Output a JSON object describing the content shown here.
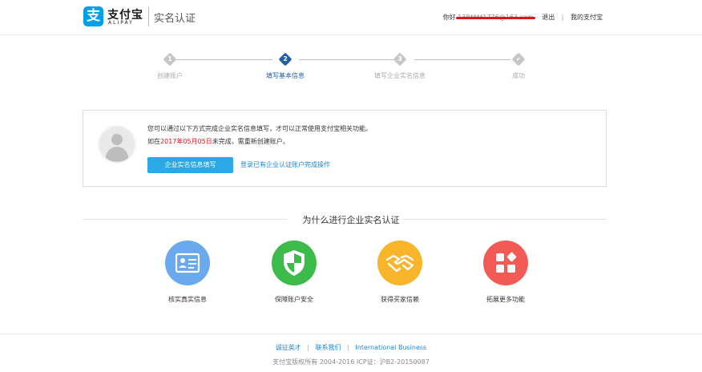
{
  "header": {
    "logo_glyph": "支",
    "logo_cn": "支付宝",
    "logo_en": "ALIPAY",
    "title": "实名认证",
    "greeting": "你好",
    "user": "138****1776@163.com",
    "logout": "退出",
    "my_alipay": "我的支付宝"
  },
  "steps": [
    {
      "num": "1",
      "label": "创建账户",
      "state": "done"
    },
    {
      "num": "2",
      "label": "填写基本信息",
      "state": "active"
    },
    {
      "num": "3",
      "label": "填写企业实名信息",
      "state": "pending"
    },
    {
      "num": "✔",
      "label": "成功",
      "state": "pending"
    }
  ],
  "notice": {
    "line1": "您可以通过以下方式完成企业实名信息填写，才可以正常使用支付宝相关功能。",
    "line2_prefix": "如在",
    "line2_date": "2017年05月05日",
    "line2_suffix": "未完成，需重新创建账户。",
    "primary_button": "企业实名信息填写",
    "alt_link": "登录已有企业认证账户完成操作"
  },
  "why": {
    "title": "为什么进行企业实名认证",
    "features": [
      {
        "label": "核实真实信息",
        "icon": "id-card-icon",
        "color": "#6aa9ee"
      },
      {
        "label": "保障账户安全",
        "icon": "shield-icon",
        "color": "#3dbb4a"
      },
      {
        "label": "获得买家信赖",
        "icon": "handshake-icon",
        "color": "#f8b42b"
      },
      {
        "label": "拓展更多功能",
        "icon": "apps-icon",
        "color": "#f25b55"
      }
    ]
  },
  "footer": {
    "links": [
      "诚征英才",
      "联系我们",
      "International Business"
    ],
    "copyright": "支付宝版权所有 2004-2016 ICP证：沪B2-20150087"
  },
  "colors": {
    "brand": "#00a0e9",
    "step_active": "#1e5fa8",
    "button": "#2aa9e6",
    "link": "#1a86d6",
    "warning": "#e0141e"
  }
}
